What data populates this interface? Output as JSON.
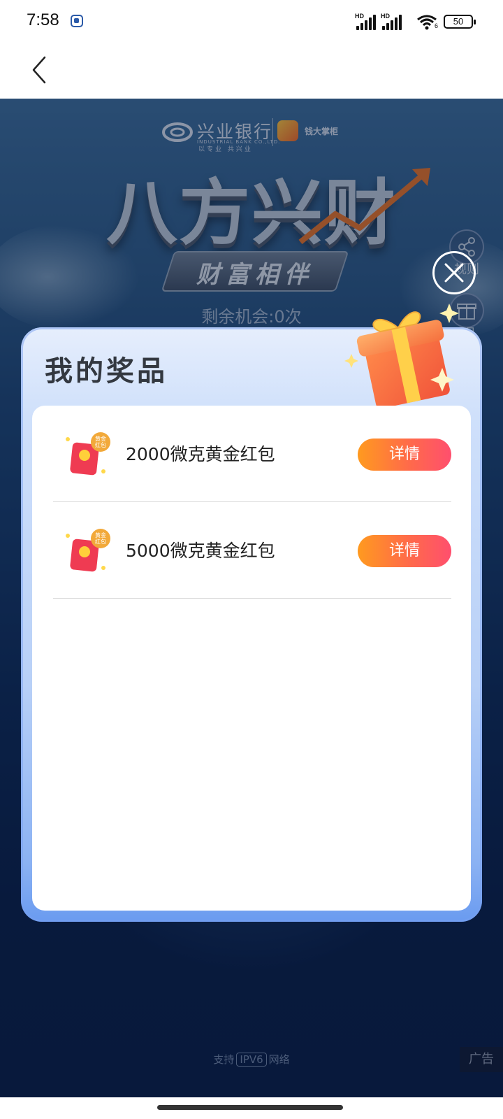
{
  "status_bar": {
    "time": "7:58",
    "signal_1_label": "HD",
    "signal_2_label": "HD",
    "wifi_sub": "6",
    "battery": "50"
  },
  "hero": {
    "bank_name": "兴业银行",
    "bank_english": "INDUSTRIAL BANK CO.,LTD.",
    "bank_slogan": "以专业 共兴业",
    "partner_name": "钱大掌柜",
    "title": "八方兴财",
    "subtitle": "财富相伴",
    "chances": "剩余机会:0次",
    "side_rules_label": "规则",
    "side_prize_label": "品",
    "footer_prefix": "支持",
    "footer_ipv6": "IPV6",
    "footer_suffix": "网络",
    "ad_label": "广告"
  },
  "modal": {
    "title": "我的奖品",
    "icon_badge_text": [
      "黄金",
      "红包"
    ],
    "prizes": [
      {
        "name": "2000微克黄金红包",
        "button": "详情"
      },
      {
        "name": "5000微克黄金红包",
        "button": "详情"
      }
    ]
  },
  "colors": {
    "button_gradient_start": "#ff9a1f",
    "button_gradient_end": "#ff4f6e",
    "modal_bg": "#cfe0fb"
  }
}
